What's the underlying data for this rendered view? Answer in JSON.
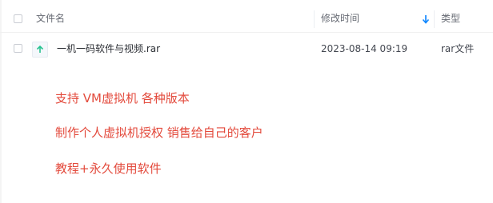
{
  "table": {
    "columns": {
      "name": "文件名",
      "mtime": "修改时间",
      "type": "类型"
    },
    "sort_icon": "arrow-down-icon",
    "rows": [
      {
        "icon": "rar-file-icon",
        "name": "一机一码软件与视频.rar",
        "mtime": "2023-08-14 09:19",
        "type": "rar文件"
      }
    ]
  },
  "promo": {
    "line1": "支持 VM虚拟机 各种版本",
    "line2": "制作个人虚拟机授权 销售给自己的客户",
    "line3": "教程+永久使用软件"
  },
  "colors": {
    "promo_text": "#e34a3c",
    "sort_icon": "#0a84ff",
    "file_icon_arrow": "#25c28f"
  }
}
